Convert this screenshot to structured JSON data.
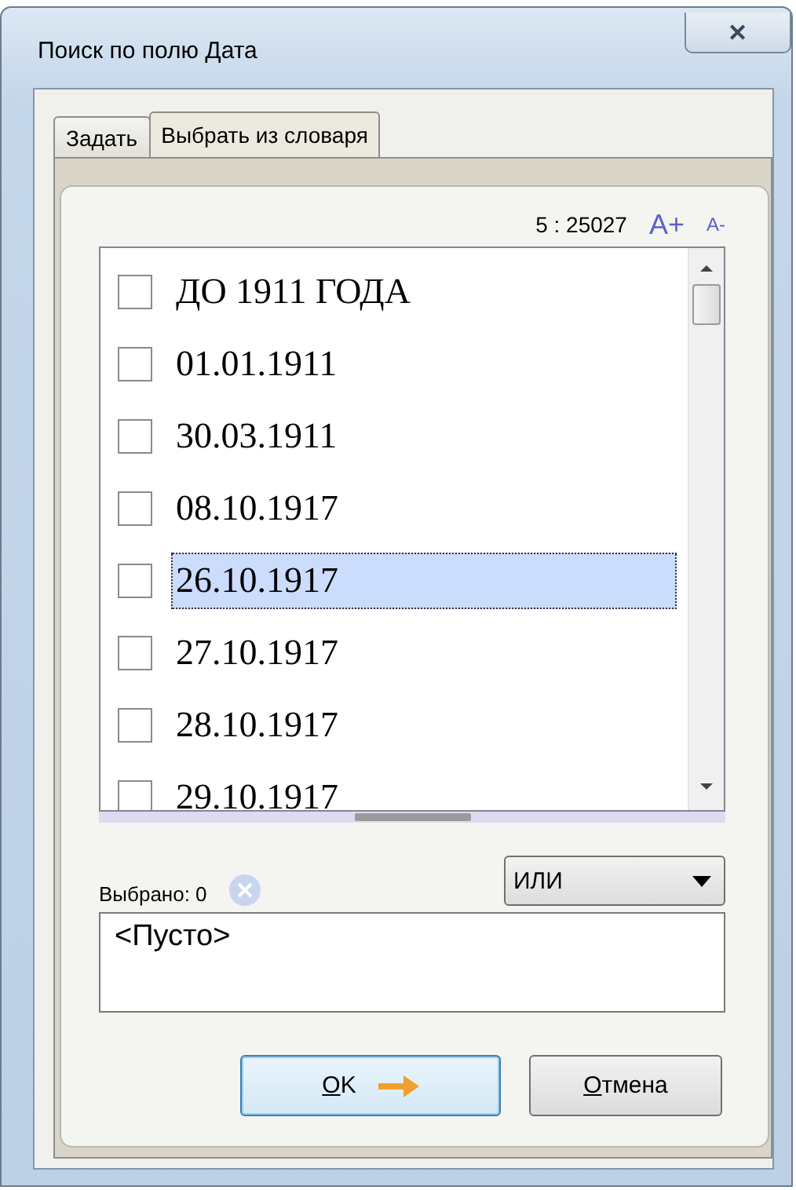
{
  "window": {
    "title": "Поиск по полю Дата",
    "close": "✕"
  },
  "tabs": [
    {
      "label": "Задать",
      "selected": false
    },
    {
      "label": "Выбрать из словаря",
      "selected": true
    }
  ],
  "counter": "5 : 25027",
  "font_larger": "A+",
  "font_smaller": "A-",
  "items": [
    {
      "label": "ДО 1911 ГОДА",
      "checked": false,
      "selected": false
    },
    {
      "label": "01.01.1911",
      "checked": false,
      "selected": false
    },
    {
      "label": "30.03.1911",
      "checked": false,
      "selected": false
    },
    {
      "label": "08.10.1917",
      "checked": false,
      "selected": false
    },
    {
      "label": "26.10.1917",
      "checked": false,
      "selected": true
    },
    {
      "label": "27.10.1917",
      "checked": false,
      "selected": false
    },
    {
      "label": "28.10.1917",
      "checked": false,
      "selected": false
    },
    {
      "label": "29.10.1917",
      "checked": false,
      "selected": false
    }
  ],
  "operator": {
    "value": "ИЛИ"
  },
  "selected_count": "Выбрано: 0",
  "selection_box": {
    "value": "<Пусто>"
  },
  "buttons": [
    {
      "label": "OK",
      "kind": "primary",
      "mnemonic": true
    },
    {
      "label": "Отмена",
      "kind": "cancel",
      "mnemonic": true
    }
  ]
}
